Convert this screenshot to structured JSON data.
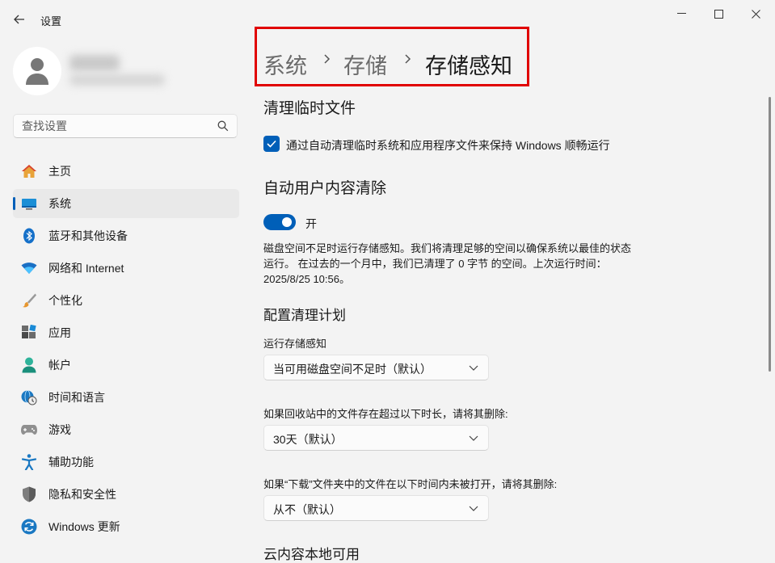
{
  "window": {
    "title": "设置",
    "back_icon": "arrow-left-icon",
    "controls": [
      "minimize-icon",
      "maximize-icon",
      "close-icon"
    ]
  },
  "search": {
    "placeholder": "查找设置"
  },
  "sidebar": {
    "items": [
      {
        "label": "主页",
        "icon": "home-icon",
        "active": false
      },
      {
        "label": "系统",
        "icon": "display-icon",
        "active": true
      },
      {
        "label": "蓝牙和其他设备",
        "icon": "bluetooth-icon",
        "active": false
      },
      {
        "label": "网络和 Internet",
        "icon": "wifi-icon",
        "active": false
      },
      {
        "label": "个性化",
        "icon": "brush-icon",
        "active": false
      },
      {
        "label": "应用",
        "icon": "apps-icon",
        "active": false
      },
      {
        "label": "帐户",
        "icon": "person-icon",
        "active": false
      },
      {
        "label": "时间和语言",
        "icon": "globe-clock-icon",
        "active": false
      },
      {
        "label": "游戏",
        "icon": "gamepad-icon",
        "active": false
      },
      {
        "label": "辅助功能",
        "icon": "accessibility-icon",
        "active": false
      },
      {
        "label": "隐私和安全性",
        "icon": "shield-icon",
        "active": false
      },
      {
        "label": "Windows 更新",
        "icon": "update-icon",
        "active": false
      }
    ]
  },
  "breadcrumb": [
    "系统",
    "存储",
    "存储感知"
  ],
  "main": {
    "temp_files": {
      "heading": "清理临时文件",
      "checkbox_label": "通过自动清理临时系统和应用程序文件来保持 Windows 顺畅运行",
      "checked": true
    },
    "auto_cleanup": {
      "heading": "自动用户内容清除",
      "toggle_label": "开",
      "toggle_on": true,
      "description": "磁盘空间不足时运行存储感知。我们将清理足够的空间以确保系统以最佳的状态运行。 在过去的一个月中，我们已清理了 0 字节 的空间。上次运行时间：2025/8/25 10:56。"
    },
    "schedule": {
      "heading": "配置清理计划",
      "run_label": "运行存储感知",
      "run_value": "当可用磁盘空间不足时（默认）",
      "recycle_label": "如果回收站中的文件存在超过以下时长，请将其删除:",
      "recycle_value": "30天（默认）",
      "downloads_label": "如果“下载”文件夹中的文件在以下时间内未被打开，请将其删除:",
      "downloads_value": "从不（默认）"
    },
    "next_heading_partial": "云内容本地可用"
  },
  "colors": {
    "accent": "#005fb8",
    "highlight_border": "#e00000",
    "background": "#f3f3f3"
  }
}
